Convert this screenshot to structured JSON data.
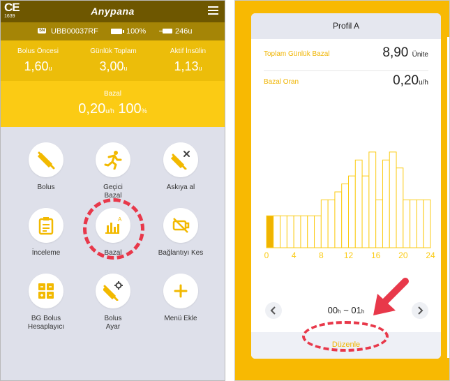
{
  "left_screen": {
    "header": {
      "ce_mark": "CE",
      "ce_number": "1639",
      "brand": "Anypana",
      "menu_icon": "hamburger-menu-icon"
    },
    "status": {
      "sn_badge": "SN",
      "serial": "UBB00037RF",
      "battery": "100%",
      "reservoir": "246u"
    },
    "stats": [
      {
        "label": "Bolus Öncesi",
        "value": "1,60",
        "unit": "u"
      },
      {
        "label": "Günlük Toplam",
        "value": "3,00",
        "unit": "u"
      },
      {
        "label": "Aktif İnsülin",
        "value": "1,13",
        "unit": "u"
      }
    ],
    "bazal": {
      "label": "Bazal",
      "value": "0,20",
      "unit": "u/h",
      "percent": "100",
      "percent_unit": "%"
    },
    "tiles": [
      {
        "label": "Bolus",
        "icon": "syringe-icon"
      },
      {
        "label": "Geçici\nBazal",
        "icon": "running-person-icon"
      },
      {
        "label": "Askıya al",
        "icon": "syringe-cancel-icon"
      },
      {
        "label": "İnceleme",
        "icon": "clipboard-icon"
      },
      {
        "label": "Bazal",
        "icon": "bar-chart-icon"
      },
      {
        "label": "Bağlantıyı Kes",
        "icon": "disconnect-icon"
      },
      {
        "label": "BG Bolus\nHesaplayıcı",
        "icon": "calculator-icon"
      },
      {
        "label": "Bolus\nAyar",
        "icon": "syringe-settings-icon"
      },
      {
        "label": "Menü Ekle",
        "icon": "plus-icon"
      }
    ],
    "highlight_color": "#e8384a"
  },
  "right_screen": {
    "profile_title": "Profil A",
    "total_daily_basal": {
      "label": "Toplam Günlük Bazal",
      "value": "8,90",
      "unit": "Ünite"
    },
    "basal_rate": {
      "label": "Bazal Oran",
      "value": "0,20",
      "unit": "u/h"
    },
    "time_range": {
      "start": "00",
      "end": "01",
      "unit": "h",
      "separator": "~"
    },
    "edit_button": "Düzenle",
    "accent_color": "#f0b400"
  },
  "chart_data": {
    "type": "bar",
    "categories": [
      "0",
      "1",
      "2",
      "3",
      "4",
      "5",
      "6",
      "7",
      "8",
      "9",
      "10",
      "11",
      "12",
      "13",
      "14",
      "15",
      "16",
      "17",
      "18",
      "19",
      "20",
      "21",
      "22",
      "23"
    ],
    "x_tick_labels": [
      "0",
      "4",
      "8",
      "12",
      "16",
      "20",
      "24"
    ],
    "values": [
      0.2,
      0.2,
      0.2,
      0.2,
      0.2,
      0.2,
      0.2,
      0.2,
      0.3,
      0.3,
      0.35,
      0.4,
      0.45,
      0.55,
      0.45,
      0.6,
      0.3,
      0.55,
      0.6,
      0.5,
      0.3,
      0.3,
      0.3,
      0.3
    ],
    "selected_index": 0,
    "colors": {
      "bar": "#fbcb14",
      "selected": "#f0b400"
    }
  }
}
